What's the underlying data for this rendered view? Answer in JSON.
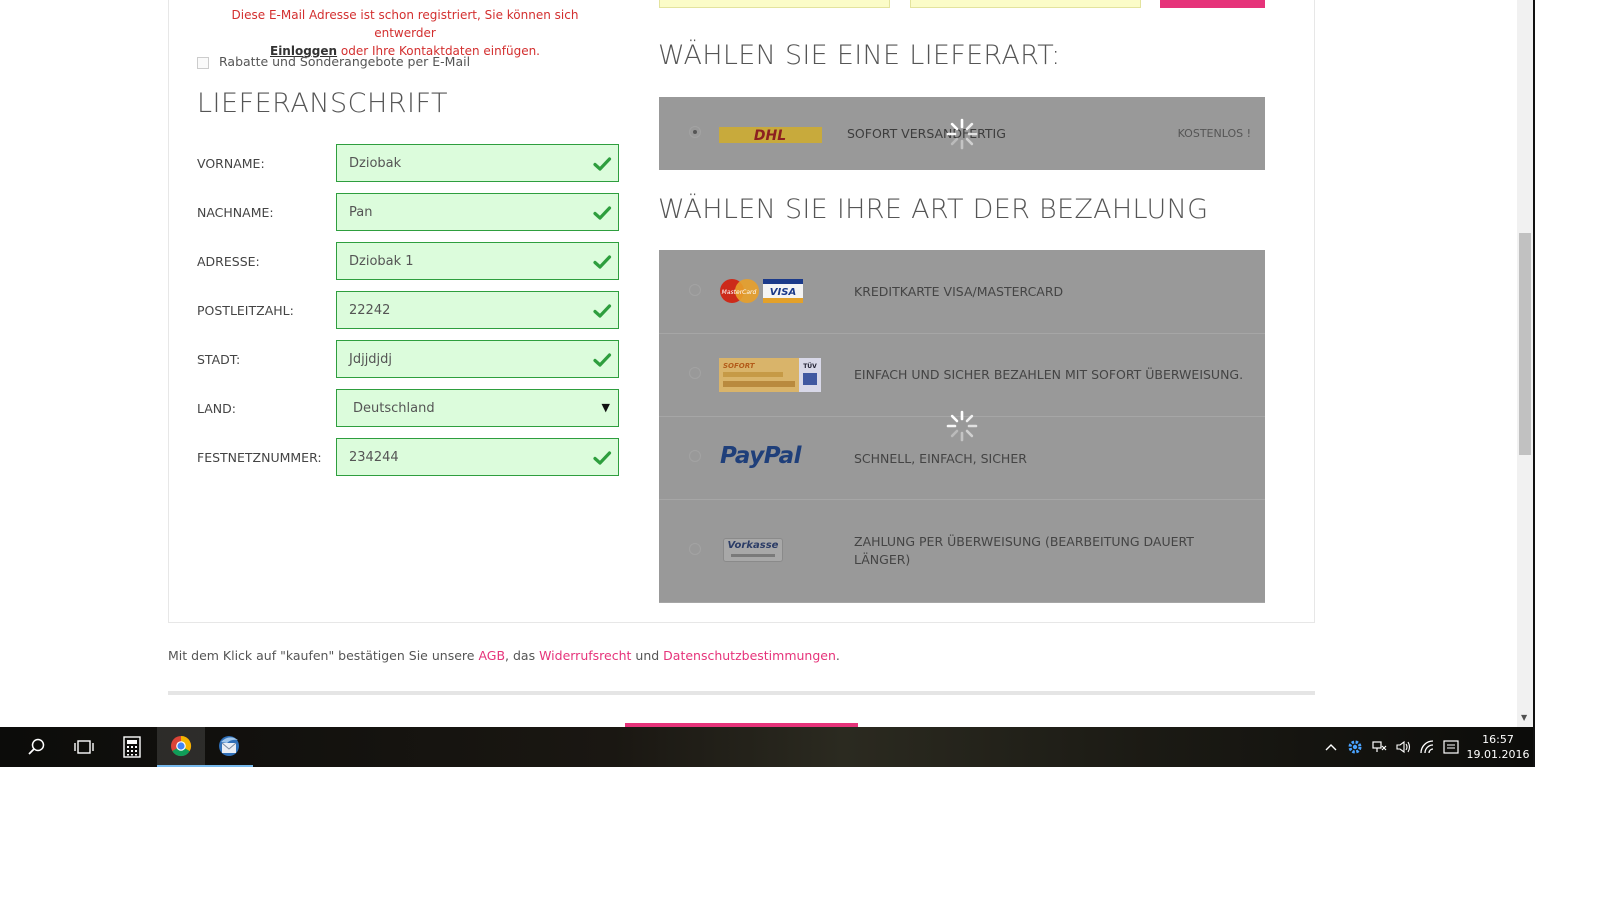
{
  "account": {
    "error_part1": "Diese E-Mail Adresse ist schon registriert, Sie können sich entwerder",
    "error_link": "Einloggen",
    "error_part2": "oder Ihre Kontaktdaten einfügen.",
    "newsletter_label": "Rabatte und Sonderangebote per E-Mail",
    "newsletter_checked": false
  },
  "delivery": {
    "heading": "LIEFERANSCHRIFT",
    "fields": [
      {
        "label": "VORNAME:",
        "value": "Dziobak",
        "valid": true
      },
      {
        "label": "NACHNAME:",
        "value": "Pan",
        "valid": true
      },
      {
        "label": "ADRESSE:",
        "value": "Dziobak 1",
        "valid": true
      },
      {
        "label": "POSTLEITZAHL:",
        "value": "22242",
        "valid": true
      },
      {
        "label": "STADT:",
        "value": "Jdjjdjdj",
        "valid": true
      },
      {
        "label": "LAND:",
        "value": "Deutschland",
        "type": "select"
      },
      {
        "label": "FESTNETZNUMMER:",
        "value": "234244",
        "valid": true
      }
    ]
  },
  "shipping": {
    "heading": "WÄHLEN SIE EINE LIEFERART:",
    "option": {
      "logo": "DHL",
      "label": "SOFORT VERSANDFERTIG",
      "price": "KOSTENLOS !",
      "selected": true
    }
  },
  "payment": {
    "heading": "WÄHLEN SIE IHRE ART DER BEZAHLUNG",
    "options": [
      {
        "logo": "mastercard-visa-logo",
        "label": "KREDITKARTE VISA/MASTERCARD"
      },
      {
        "logo": "sofort-logo",
        "label": "EINFACH UND SICHER BEZAHLEN MIT SOFORT ÜBERWEISUNG."
      },
      {
        "logo": "PayPal",
        "label": "SCHNELL, EINFACH, SICHER"
      },
      {
        "logo": "Vorkasse",
        "label": "ZAHLUNG PER ÜBERWEISUNG (BEARBEITUNG DAUERT LÄNGER)"
      }
    ]
  },
  "legal": {
    "prefix": "Mit dem Klick auf \"kaufen\" bestätigen Sie unsere",
    "agb": "AGB",
    "sep1": ", das",
    "widerruf": "Widerrufsrecht",
    "sep2": "und",
    "datenschutz": "Datenschutzbestimmungen",
    "suffix": "."
  },
  "taskbar": {
    "time": "16:57",
    "date": "19.01.2016",
    "apps": [
      "search-icon",
      "task-view-icon",
      "calculator-icon",
      "chrome-icon",
      "thunderbird-icon"
    ]
  },
  "colors": {
    "accent": "#e6337a",
    "valid_border": "#2e9e3e",
    "valid_bg": "#dcfcdc",
    "error": "#d32f2f",
    "loading_overlay": "#999999"
  }
}
